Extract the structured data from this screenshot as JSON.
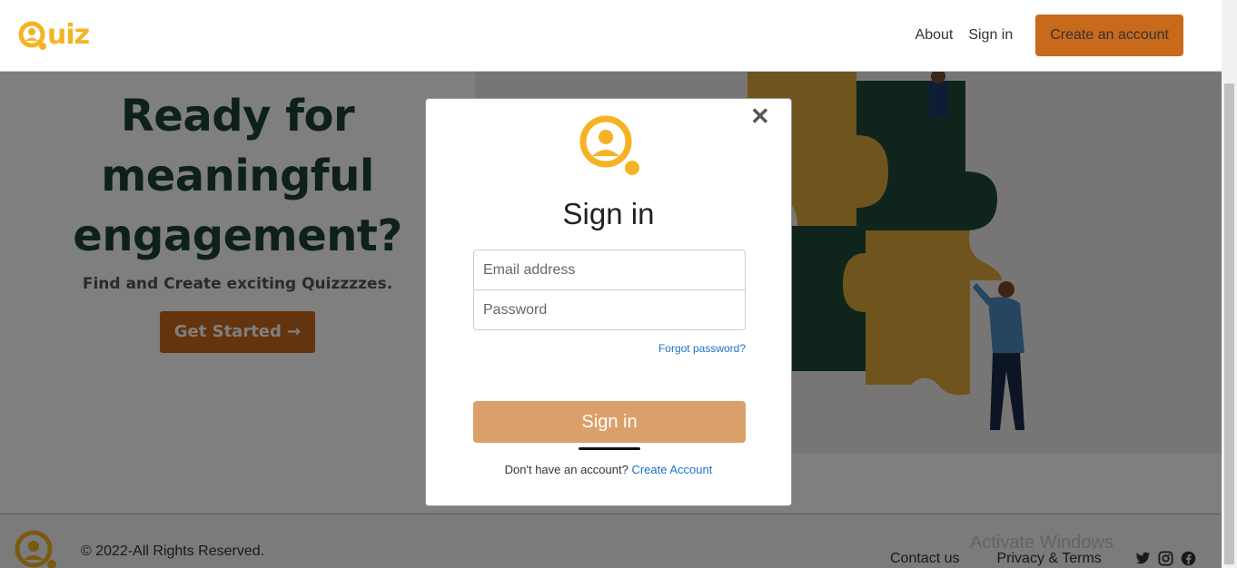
{
  "header": {
    "logo_text": "uiz",
    "nav": {
      "about": "About",
      "sign_in": "Sign in",
      "create_account": "Create an account"
    }
  },
  "hero": {
    "title_line1": "Ready for",
    "title_line2": "meaningful",
    "title_line3": "engagement?",
    "subtitle": "Find and Create exciting Quizzzzes.",
    "cta": "Get Started →"
  },
  "footer": {
    "copyright": "© 2022-All Rights Reserved.",
    "contact": "Contact us",
    "privacy": "Privacy & Terms",
    "watermark": "Activate Windows"
  },
  "modal": {
    "title": "Sign in",
    "email_placeholder": "Email address",
    "password_placeholder": "Password",
    "forgot": "Forgot password?",
    "submit": "Sign in",
    "no_account": "Don't have an account?",
    "create_link": "Create Account",
    "close_symbol": "✕"
  },
  "colors": {
    "brand_orange": "#c8691c",
    "logo_yellow": "#f5b323",
    "dark_green": "#1b4233",
    "link_blue": "#1a73c8"
  },
  "icons": [
    "quiz-logo-icon",
    "close-icon",
    "twitter-icon",
    "instagram-icon",
    "facebook-icon"
  ]
}
